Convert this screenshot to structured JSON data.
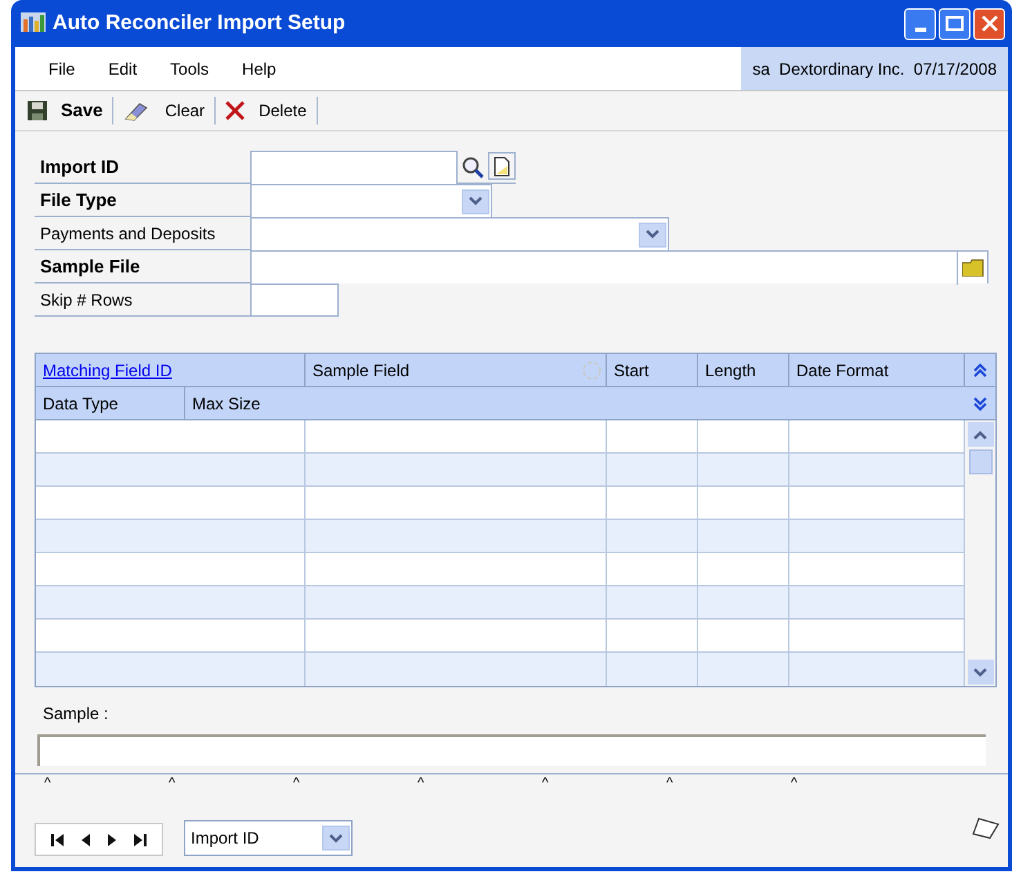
{
  "window": {
    "title": "Auto Reconciler Import Setup"
  },
  "menu": [
    "File",
    "Edit",
    "Tools",
    "Help"
  ],
  "user_info": "sa  Dextordinary Inc.  07/17/2008",
  "toolbar": [
    {
      "kind": "save",
      "label": "Save"
    },
    {
      "kind": "clear",
      "label": "Clear"
    },
    {
      "kind": "delete",
      "label": "Delete"
    }
  ],
  "form": [
    {
      "label": "Import ID",
      "required": true,
      "kind": "lookup"
    },
    {
      "label": "File Type",
      "required": true,
      "kind": "dropdown"
    },
    {
      "label": "Payments and Deposits",
      "required": false,
      "kind": "wide-dropdown"
    },
    {
      "label": "Sample File",
      "required": true,
      "kind": "file"
    },
    {
      "label": "Skip # Rows",
      "required": false,
      "kind": "short"
    }
  ],
  "grid": {
    "header_row_1": [
      {
        "label": "Matching Field ID",
        "kind": "link"
      },
      {
        "label": "Sample Field",
        "kind": "text"
      },
      {
        "label": "Start",
        "kind": "text"
      },
      {
        "label": "Length",
        "kind": "text"
      },
      {
        "label": "Date Format",
        "kind": "text"
      }
    ],
    "header_row_2": [
      "Data Type",
      "Max Size"
    ]
  },
  "sample": {
    "label": "Sample :"
  },
  "column_markers": [
    "^",
    "^",
    "^",
    "^",
    "^",
    "^",
    "^"
  ],
  "browse": {
    "sort_by": "Import ID"
  }
}
